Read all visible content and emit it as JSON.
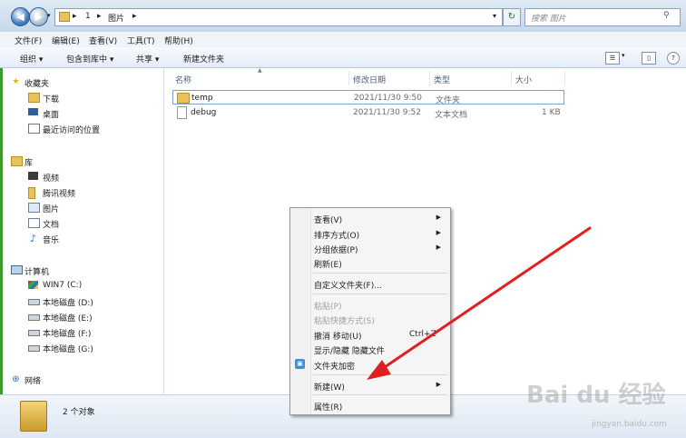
{
  "address": {
    "crumbs": [
      "1",
      "图片"
    ],
    "separator": "▸",
    "search_placeholder": "搜索 图片"
  },
  "menu": [
    "文件(F)",
    "编辑(E)",
    "查看(V)",
    "工具(T)",
    "帮助(H)"
  ],
  "toolbar": {
    "organize": "组织 ▾",
    "include_library": "包含到库中 ▾",
    "share": "共享 ▾",
    "new_folder": "新建文件夹"
  },
  "nav": {
    "favorites": "收藏夹",
    "downloads": "下载",
    "desktop": "桌面",
    "recent": "最近访问的位置",
    "libraries": "库",
    "videos": "视频",
    "tencent_video": "腾讯视频",
    "pictures": "图片",
    "documents": "文档",
    "music": "音乐",
    "computer": "计算机",
    "drive_c": "WIN7 (C:)",
    "drive_d": "本地磁盘 (D:)",
    "drive_e": "本地磁盘 (E:)",
    "drive_f": "本地磁盘 (F:)",
    "drive_g": "本地磁盘 (G:)",
    "network": "网络"
  },
  "columns": {
    "name": "名称",
    "date": "修改日期",
    "type": "类型",
    "size": "大小"
  },
  "files": [
    {
      "name": "temp",
      "date": "2021/11/30 9:50",
      "type": "文件夹",
      "size": ""
    },
    {
      "name": "debug",
      "date": "2021/11/30 9:52",
      "type": "文本文档",
      "size": "1 KB"
    }
  ],
  "status": "2 个对象",
  "context_menu": {
    "view": "查看(V)",
    "sort": "排序方式(O)",
    "group": "分组依据(P)",
    "refresh": "刷新(E)",
    "customize": "自定义文件夹(F)...",
    "paste": "粘贴(P)",
    "paste_shortcut": "粘贴快捷方式(S)",
    "undo_move": "撤消 移动(U)",
    "undo_accel": "Ctrl+Z",
    "show_hide": "显示/隐藏 隐藏文件",
    "encrypt": "文件夹加密",
    "new": "新建(W)",
    "properties": "属性(R)"
  },
  "watermark": {
    "main": "Bai du 经验",
    "sub": "jingyan.baidu.com"
  },
  "colors": {
    "arrow": "#e02020",
    "selection_border": "#7da2ce",
    "folder": "#e8c35c"
  }
}
